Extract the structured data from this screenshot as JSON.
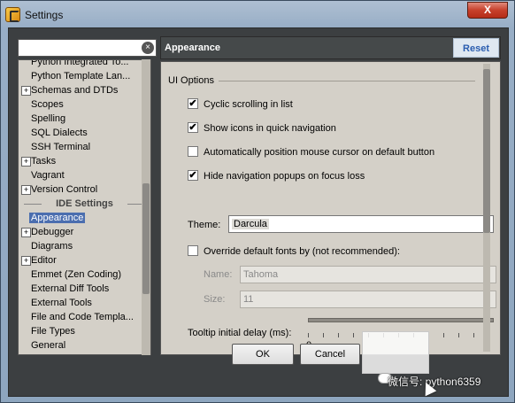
{
  "window": {
    "title": "Settings",
    "close_label": "X"
  },
  "search": {
    "value": ""
  },
  "tree": {
    "items": [
      {
        "label": "Python Integrated To...",
        "expandable": false,
        "cut": true
      },
      {
        "label": "Python Template Lan...",
        "expandable": false
      },
      {
        "label": "Schemas and DTDs",
        "expandable": true
      },
      {
        "label": "Scopes",
        "expandable": false
      },
      {
        "label": "Spelling",
        "expandable": false
      },
      {
        "label": "SQL Dialects",
        "expandable": false
      },
      {
        "label": "SSH Terminal",
        "expandable": false
      },
      {
        "label": "Tasks",
        "expandable": true
      },
      {
        "label": "Vagrant",
        "expandable": false
      },
      {
        "label": "Version Control",
        "expandable": true
      }
    ],
    "section_header": "IDE Settings",
    "items_after": [
      {
        "label": "Appearance",
        "expandable": false,
        "selected": true
      },
      {
        "label": "Debugger",
        "expandable": true
      },
      {
        "label": "Diagrams",
        "expandable": false
      },
      {
        "label": "Editor",
        "expandable": true
      },
      {
        "label": "Emmet (Zen Coding)",
        "expandable": false
      },
      {
        "label": "External Diff Tools",
        "expandable": false
      },
      {
        "label": "External Tools",
        "expandable": false
      },
      {
        "label": "File and Code Templa...",
        "expandable": false
      },
      {
        "label": "File Types",
        "expandable": false
      },
      {
        "label": "General",
        "expandable": false
      }
    ]
  },
  "panel": {
    "title": "Appearance",
    "reset_label": "Reset",
    "group_title": "UI Options",
    "options": [
      {
        "label": "Cyclic scrolling in list",
        "checked": true
      },
      {
        "label": "Show icons in quick navigation",
        "checked": true
      },
      {
        "label": "Automatically position mouse cursor on default button",
        "checked": false
      },
      {
        "label": "Hide navigation popups on focus loss",
        "checked": true
      }
    ],
    "theme_label": "Theme:",
    "theme_value": "Darcula",
    "override_label": "Override default fonts by (not recommended):",
    "override_checked": false,
    "name_label": "Name:",
    "name_value": "Tahoma",
    "size_label": "Size:",
    "size_value": "11",
    "tooltip_label": "Tooltip initial delay (ms):",
    "slider_min": "0"
  },
  "buttons": {
    "ok": "OK",
    "cancel": "Cancel"
  },
  "watermark": {
    "text": "微信号: python6359"
  }
}
